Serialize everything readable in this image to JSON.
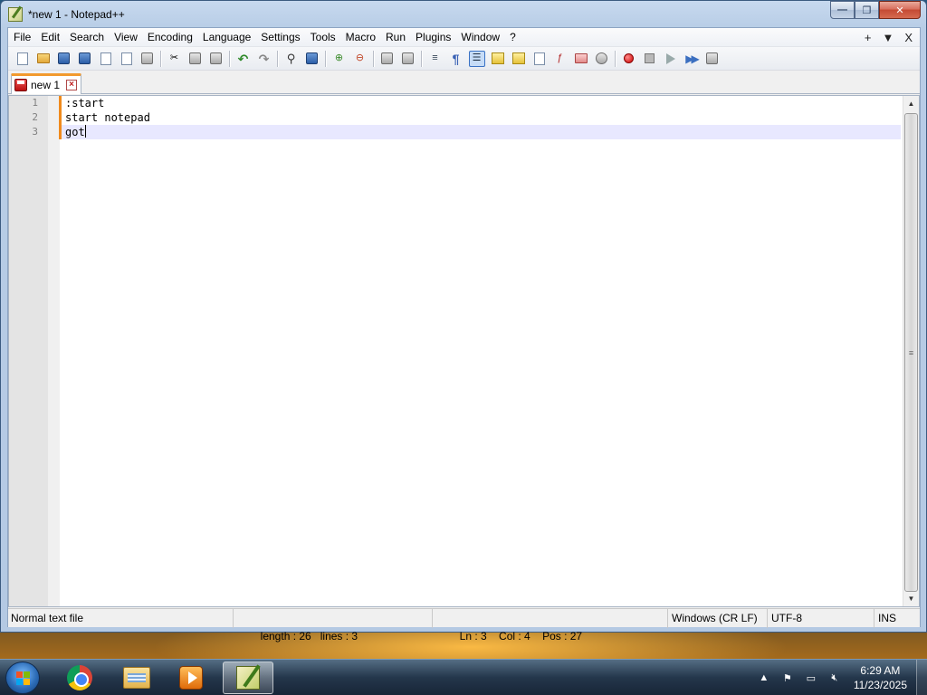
{
  "window": {
    "title": "*new 1 - Notepad++",
    "controls": {
      "minimize": "—",
      "maximize": "❐",
      "close": "✕"
    }
  },
  "menu": {
    "items": [
      "File",
      "Edit",
      "Search",
      "View",
      "Encoding",
      "Language",
      "Settings",
      "Tools",
      "Macro",
      "Run",
      "Plugins",
      "Window",
      "?"
    ],
    "right": [
      "+",
      "▼",
      "X"
    ]
  },
  "tabs": [
    {
      "label": "new 1",
      "modified": true
    }
  ],
  "editor": {
    "lines": [
      {
        "number": "1",
        "text": ":start"
      },
      {
        "number": "2",
        "text": "start notepad"
      },
      {
        "number": "3",
        "text": "got"
      }
    ],
    "current_line": 3
  },
  "status": {
    "file_type": "Normal text file",
    "length": "length : 26",
    "lines": "lines : 3",
    "ln": "Ln : 3",
    "col": "Col : 4",
    "pos": "Pos : 27",
    "eol": "Windows (CR LF)",
    "encoding": "UTF-8",
    "mode": "INS"
  },
  "taskbar": {
    "apps": [
      {
        "name": "chrome-icon"
      },
      {
        "name": "explorer-icon"
      },
      {
        "name": "media-player-icon"
      },
      {
        "name": "notepadpp-icon",
        "active": true
      }
    ],
    "clock": {
      "time": "6:29 AM",
      "date": "11/23/2025"
    }
  },
  "colors": {
    "modified_marker": "#f08a1c",
    "current_line_bg": "#e8e8ff",
    "gutter_bg": "#e4e4e4"
  }
}
